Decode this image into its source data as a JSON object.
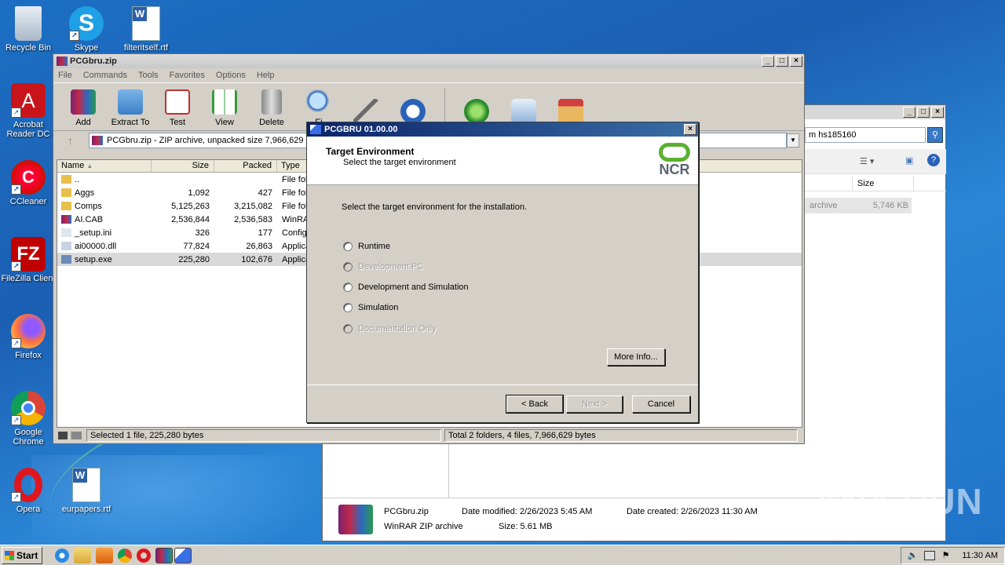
{
  "desktop": {
    "icons": [
      {
        "label": "Recycle Bin"
      },
      {
        "label": "Skype"
      },
      {
        "label": "filteritself.rtf"
      },
      {
        "label": "Acrobat Reader DC"
      },
      {
        "label": "CCleaner"
      },
      {
        "label": "FileZilla Client"
      },
      {
        "label": "Firefox"
      },
      {
        "label": "Google Chrome"
      },
      {
        "label": "Opera"
      },
      {
        "label": "eurpapers.rtf"
      }
    ]
  },
  "winrar": {
    "title": "PCGbru.zip",
    "menu": [
      "File",
      "Commands",
      "Tools",
      "Favorites",
      "Options",
      "Help"
    ],
    "tools": [
      "Add",
      "Extract To",
      "Test",
      "View",
      "Delete",
      "Fi"
    ],
    "address": "PCGbru.zip - ZIP archive, unpacked size 7,966,629",
    "columns": [
      "Name",
      "Size",
      "Packed",
      "Type"
    ],
    "files": [
      {
        "name": "..",
        "size": "",
        "packed": "",
        "type": "File fol"
      },
      {
        "name": "Aggs",
        "size": "1,092",
        "packed": "427",
        "type": "File fol"
      },
      {
        "name": "Comps",
        "size": "5,125,263",
        "packed": "3,215,082",
        "type": "File fol"
      },
      {
        "name": "AI.CAB",
        "size": "2,536,844",
        "packed": "2,536,583",
        "type": "WinRA"
      },
      {
        "name": "_setup.ini",
        "size": "326",
        "packed": "177",
        "type": "Config"
      },
      {
        "name": "ai00000.dll",
        "size": "77,824",
        "packed": "26,863",
        "type": "Applica"
      },
      {
        "name": "setup.exe",
        "size": "225,280",
        "packed": "102,676",
        "type": "Applica"
      }
    ],
    "status_left": "Selected 1 file, 225,280 bytes",
    "status_right": "Total 2 folders, 4 files, 7,966,629 bytes"
  },
  "explorer": {
    "search": "m hs185160",
    "col_size": "Size",
    "row_type": "archive",
    "row_size": "5,746 KB",
    "details": {
      "name": "PCGbru.zip",
      "modified_label": "Date modified:",
      "modified": "2/26/2023 5:45 AM",
      "created_label": "Date created:",
      "created": "2/26/2023 11:30 AM",
      "type": "WinRAR ZIP archive",
      "size_label": "Size:",
      "size": "5.61 MB"
    }
  },
  "dialog": {
    "title": "PCGBRU 01.00.00",
    "heading": "Target Environment",
    "subheading": "Select the target environment",
    "logo_text": "NCR",
    "prompt": "Select the target environment for the installation.",
    "options": [
      {
        "label": "Runtime",
        "enabled": true
      },
      {
        "label": "Development PC",
        "enabled": false
      },
      {
        "label": "Development and Simulation",
        "enabled": true
      },
      {
        "label": "Simulation",
        "enabled": true
      },
      {
        "label": "Documentation Only",
        "enabled": false
      }
    ],
    "more_info": "More Info...",
    "back": "< Back",
    "next": "Next >",
    "cancel": "Cancel"
  },
  "taskbar": {
    "start": "Start",
    "clock": "11:30 AM"
  },
  "watermark": "ANY RUN"
}
